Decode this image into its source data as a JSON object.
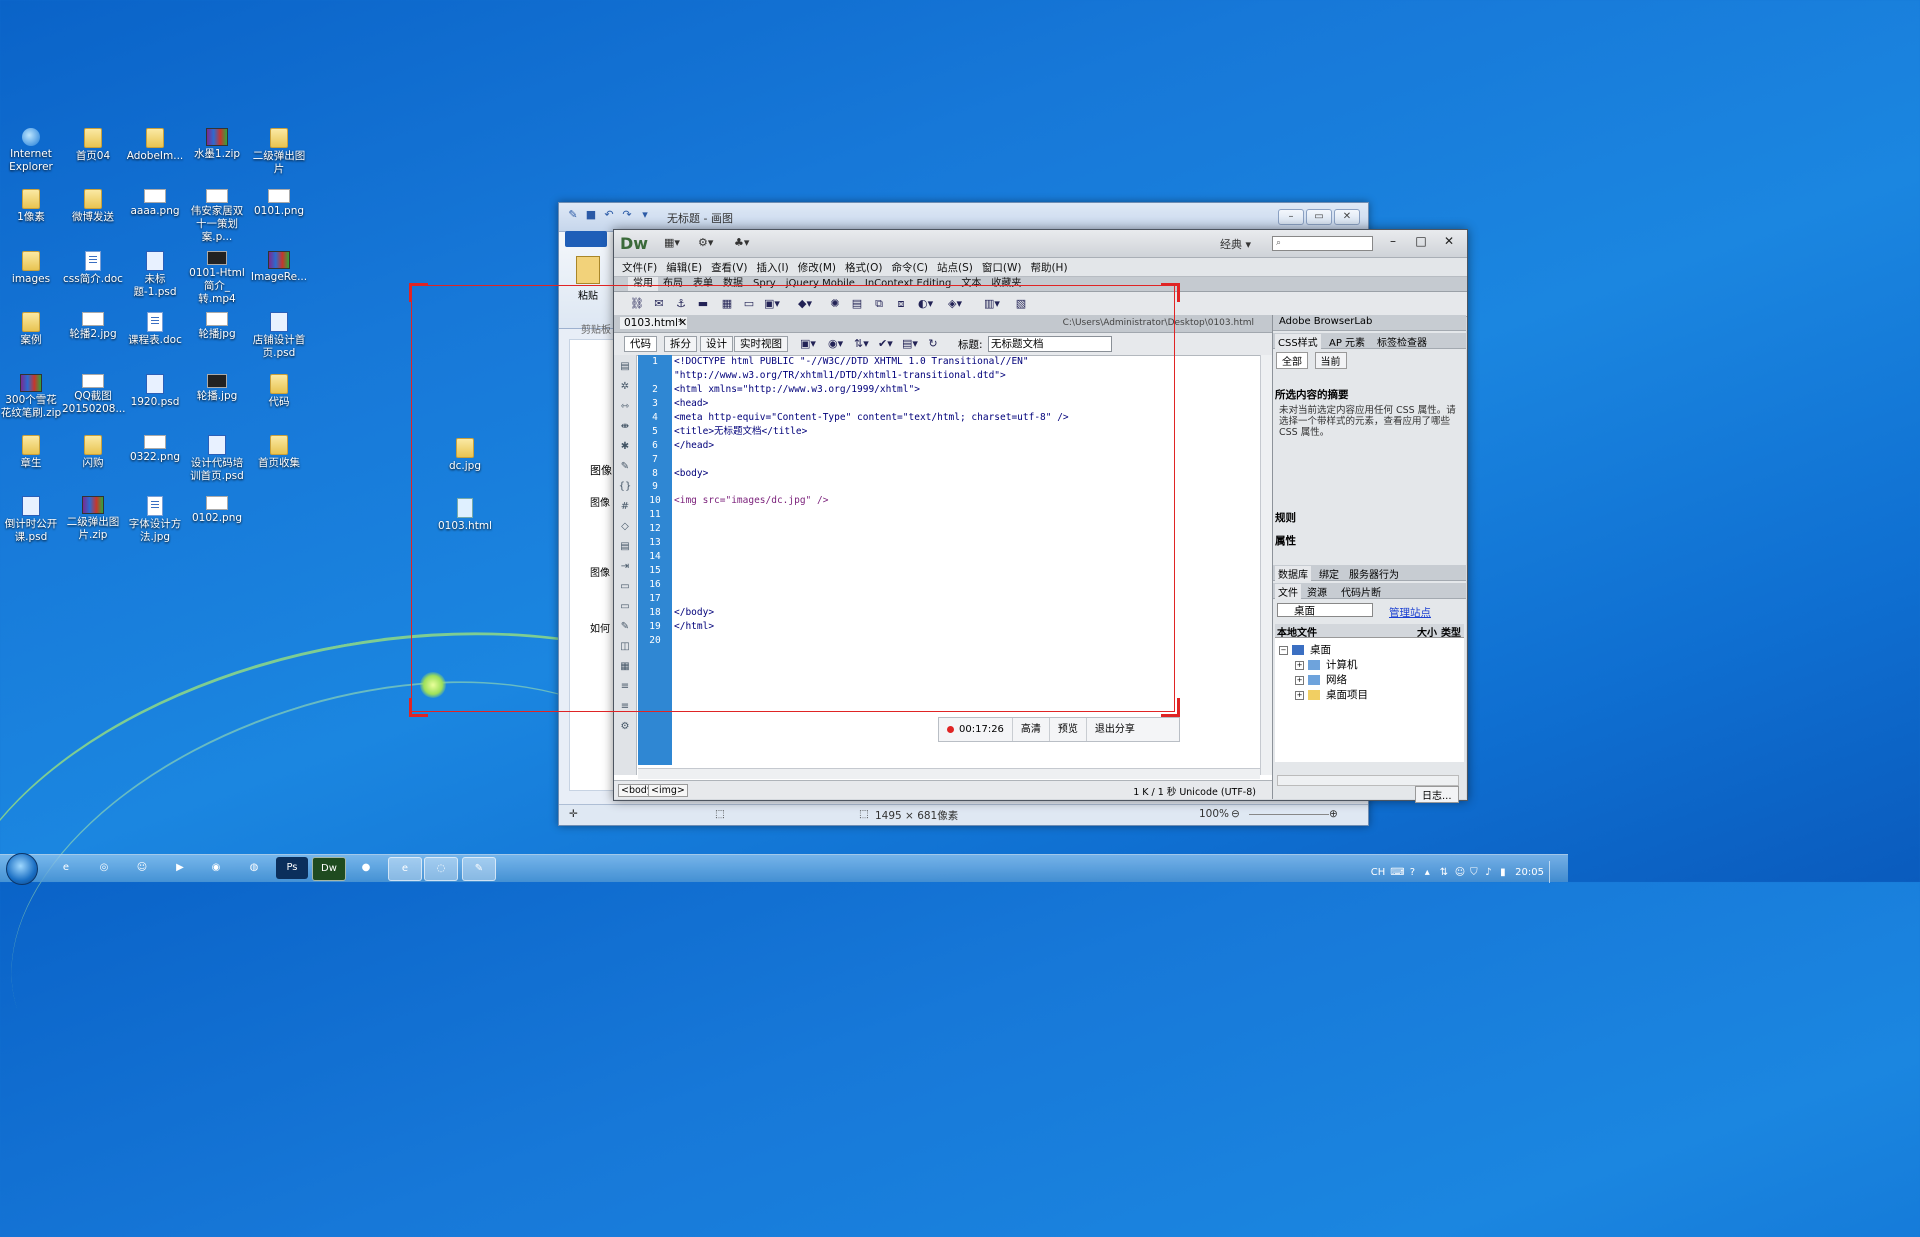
{
  "desktop": {
    "icons": [
      {
        "label": "Internet Explorer",
        "type": "ie"
      },
      {
        "label": "首页04",
        "type": "folder"
      },
      {
        "label": "AdobeIm...",
        "type": "folder"
      },
      {
        "label": "水墨1.zip",
        "type": "zip"
      },
      {
        "label": "二级弹出图片",
        "type": "folder"
      },
      {
        "label": "1像素",
        "type": "folder"
      },
      {
        "label": "微博发送",
        "type": "folder"
      },
      {
        "label": "aaaa.png",
        "type": "png"
      },
      {
        "label": "伟安家居双十一策划案.p...",
        "type": "png"
      },
      {
        "label": "0101.png",
        "type": "png"
      },
      {
        "label": "images",
        "type": "folder"
      },
      {
        "label": "css简介.doc",
        "type": "doc"
      },
      {
        "label": "未标题-1.psd",
        "type": "psd"
      },
      {
        "label": "0101-Html简介_转.mp4",
        "type": "mp4"
      },
      {
        "label": "ImageRe...",
        "type": "zip"
      },
      {
        "label": "案例",
        "type": "folder"
      },
      {
        "label": "轮播2.jpg",
        "type": "png"
      },
      {
        "label": "课程表.doc",
        "type": "doc"
      },
      {
        "label": "轮播jpg",
        "type": "png"
      },
      {
        "label": "店铺设计首页.psd",
        "type": "psd"
      },
      {
        "label": "300个雪花花纹笔刷.zip",
        "type": "zip"
      },
      {
        "label": "QQ截图20150208...",
        "type": "png"
      },
      {
        "label": "1920.psd",
        "type": "psd"
      },
      {
        "label": "轮播.jpg",
        "type": "mp4"
      },
      {
        "label": "代码",
        "type": "folder"
      },
      {
        "label": "章生",
        "type": "folder"
      },
      {
        "label": "闪购",
        "type": "folder"
      },
      {
        "label": "0322.png",
        "type": "png"
      },
      {
        "label": "设计代码培训首页.psd",
        "type": "psd"
      },
      {
        "label": "首页收集",
        "type": "folder"
      },
      {
        "label": "倒计时公开课.psd",
        "type": "psd"
      },
      {
        "label": "二级弹出图片.zip",
        "type": "zip"
      },
      {
        "label": "字体设计方法.jpg",
        "type": "doc"
      },
      {
        "label": "0102.png",
        "type": "png"
      },
      {
        "label": "dc.jpg",
        "type": "folder"
      },
      {
        "label": "0103.html",
        "type": "html"
      }
    ]
  },
  "paint": {
    "title": "无标题 - 画图",
    "paste_label": "粘贴",
    "clipboard_label": "剪贴板",
    "canvas_texts": [
      "图像",
      "图像",
      "图像",
      "如何"
    ],
    "status_size": "1495 × 681像素",
    "zoom": "100%"
  },
  "dreamweaver": {
    "logo": "Dw",
    "workspace": "经典",
    "menu": [
      "文件(F)",
      "编辑(E)",
      "查看(V)",
      "插入(I)",
      "修改(M)",
      "格式(O)",
      "命令(C)",
      "站点(S)",
      "窗口(W)",
      "帮助(H)"
    ],
    "insert_tabs": [
      "常用",
      "布局",
      "表单",
      "数据",
      "Spry",
      "jQuery Mobile",
      "InContext Editing",
      "文本",
      "收藏夹"
    ],
    "doc_tab": "0103.html*",
    "doc_path": "C:\\Users\\Administrator\\Desktop\\0103.html",
    "view_buttons": [
      "代码",
      "拆分",
      "设计",
      "实时视图"
    ],
    "title_label": "标题:",
    "title_value": "无标题文档",
    "line_numbers": [
      "1",
      "",
      "2",
      "3",
      "4",
      "5",
      "6",
      "7",
      "8",
      "9",
      "10",
      "11",
      "12",
      "13",
      "14",
      "15",
      "16",
      "17",
      "18",
      "19",
      "20"
    ],
    "code_lines": [
      "<!DOCTYPE html PUBLIC \"-//W3C//DTD XHTML 1.0 Transitional//EN\"",
      "\"http://www.w3.org/TR/xhtml1/DTD/xhtml1-transitional.dtd\">",
      "<html xmlns=\"http://www.w3.org/1999/xhtml\">",
      "<head>",
      "<meta http-equiv=\"Content-Type\" content=\"text/html; charset=utf-8\" />",
      "<title>无标题文档</title>",
      "</head>",
      "",
      "<body>",
      "",
      "<img src=\"images/dc.jpg\" />",
      "",
      "",
      "",
      "",
      "",
      "",
      "",
      "</body>",
      "</html>",
      ""
    ],
    "tag_selector": [
      "<body>",
      "<img>"
    ],
    "status_right": "1 K / 1 秒  Unicode (UTF-8)",
    "panels": {
      "browserlab": "Adobe BrowserLab",
      "css_tabs": [
        "CSS样式",
        "AP 元素",
        "标签检查器"
      ],
      "css_buttons": [
        "全部",
        "当前"
      ],
      "summary_title": "所选内容的摘要",
      "summary_note": "未对当前选定内容应用任何 CSS 属性。请选择一个带样式的元素，查看应用了哪些 CSS 属性。",
      "rules_label": "规则",
      "props_label": "属性",
      "db_tabs": [
        "数据库",
        "绑定",
        "服务器行为"
      ],
      "file_tabs": [
        "文件",
        "资源",
        "代码片断"
      ],
      "site_select": "桌面",
      "manage_site": "管理站点",
      "local_files": "本地文件",
      "size_col": "大小",
      "type_col": "类型",
      "tree": [
        {
          "label": "桌面",
          "level": 0
        },
        {
          "label": "计算机",
          "level": 1
        },
        {
          "label": "网络",
          "level": 1
        },
        {
          "label": "桌面项目",
          "level": 1
        }
      ],
      "log_button": "日志..."
    }
  },
  "recorder": {
    "time": "00:17:26",
    "buttons": [
      "高清",
      "预览",
      "退出分享"
    ]
  },
  "taskbar": {
    "apps": [
      "ie",
      "explorer",
      "qq",
      "media",
      "firefox",
      "chrome",
      "Ps",
      "Dw",
      "record",
      "ie2",
      "browser",
      "paint"
    ],
    "tray_lang": "CH",
    "clock": "20:05"
  }
}
